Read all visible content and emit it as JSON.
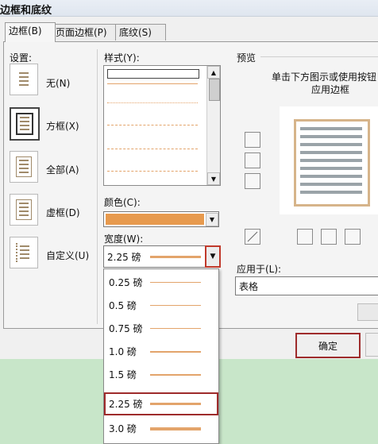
{
  "dialog": {
    "title": "边框和底纹",
    "tabs": [
      "边框(B)",
      "页面边框(P)",
      "底纹(S)"
    ]
  },
  "settings": {
    "label": "设置:",
    "items": [
      "无(N)",
      "方框(X)",
      "全部(A)",
      "虚框(D)",
      "自定义(U)"
    ],
    "selected": "方框(X)"
  },
  "style": {
    "label": "样式(Y):"
  },
  "color": {
    "label": "颜色(C):",
    "value_hex": "#e79a4e"
  },
  "width": {
    "label": "宽度(W):",
    "value": "2.25 磅",
    "options": [
      "0.25 磅",
      "0.5 磅",
      "0.75 磅",
      "1.0 磅",
      "1.5 磅",
      "2.25 磅",
      "3.0 磅"
    ],
    "selected": "2.25 磅"
  },
  "preview": {
    "label": "预览",
    "hint_line1": "单击下方图示或使用按钮",
    "hint_line2": "应用边框"
  },
  "apply_to": {
    "label": "应用于(L):",
    "value": "表格"
  },
  "buttons": {
    "ok": "确定"
  },
  "icons": [
    "dropdown-arrow-icon",
    "scroll-up-icon",
    "scroll-down-icon",
    "border-top-icon",
    "border-middle-icon",
    "border-bottom-icon",
    "border-diagonal-icon",
    "border-left-icon",
    "border-center-icon",
    "border-right-icon"
  ]
}
